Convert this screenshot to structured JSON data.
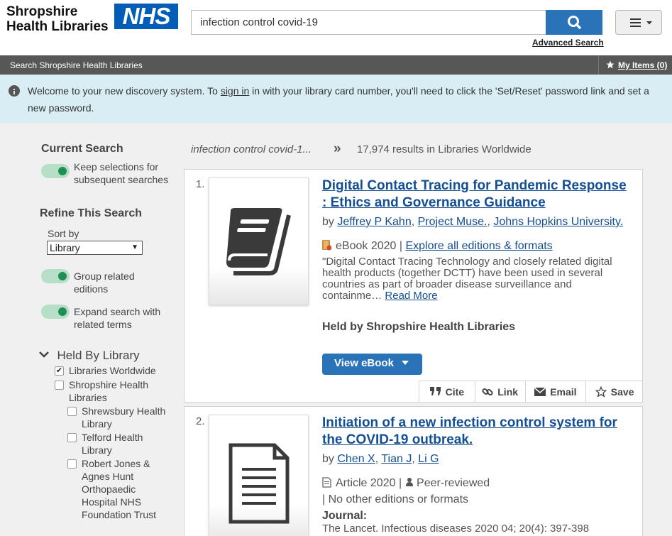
{
  "header": {
    "brand_line1": "Shropshire",
    "brand_line2": "Health Libraries",
    "nhs_logo": "NHS",
    "search_value": "infection control covid-19",
    "advanced_search": "Advanced Search"
  },
  "navbar": {
    "title": "Search Shropshire Health Libraries",
    "my_items": "My Items (0)"
  },
  "banner": {
    "text_before": "Welcome to your new discovery system. To ",
    "sign_in": "sign in",
    "text_after": " in with your library card number, you'll need to click the 'Set/Reset' password link and set a new password."
  },
  "sidebar": {
    "current_search_title": "Current Search",
    "keep_selections": "Keep selections for subsequent searches",
    "refine_title": "Refine This Search",
    "sort_by_label": "Sort by",
    "sort_by_value": "Library",
    "group_related": "Group related editions",
    "expand_search": "Expand search with related terms",
    "held_by_title": "Held By Library",
    "libraries": [
      {
        "label": "Libraries Worldwide",
        "checked": true
      },
      {
        "label": "Shropshire Health Libraries",
        "checked": false
      },
      {
        "label": "Shrewsbury Health Library",
        "checked": false
      },
      {
        "label": "Telford Health Library",
        "checked": false
      },
      {
        "label": "Robert Jones & Agnes Hunt Orthopaedic Hospital NHS Foundation Trust",
        "checked": false
      }
    ]
  },
  "results_header": {
    "query": "infection control covid-1...",
    "separator": "»",
    "count": "17,974 results in Libraries Worldwide"
  },
  "results": [
    {
      "number": "1.",
      "title": "Digital Contact Tracing for Pandemic Response : Ethics and Governance Guidance",
      "by": "by",
      "authors": [
        "Jeffrey P Kahn",
        "Project Muse.",
        "Johns Hopkins University."
      ],
      "format": "eBook 2020",
      "format_sep": "|",
      "editions_link": "Explore all editions & formats",
      "description": "\"Digital Contact Tracing Technology and closely related digital health products (together DCTT) have been used in several countries as part of broader disease surveillance and containme…",
      "read_more": "Read More",
      "held_by": "Held by Shropshire Health Libraries",
      "view_button": "View eBook",
      "actions": [
        "Cite",
        "Link",
        "Email",
        "Save"
      ]
    },
    {
      "number": "2.",
      "title": "Initiation of a new infection control system for the COVID-19 outbreak.",
      "by": "by",
      "authors": [
        "Chen X",
        "Tian J",
        "Li G"
      ],
      "format": "Article 2020",
      "format_sep": "|",
      "peer_reviewed": "Peer-reviewed",
      "no_editions": "| No other editions or formats",
      "journal_label": "Journal:",
      "journal_value": "The Lancet. Infectious diseases 2020 04; 20(4): 397-398"
    }
  ]
}
